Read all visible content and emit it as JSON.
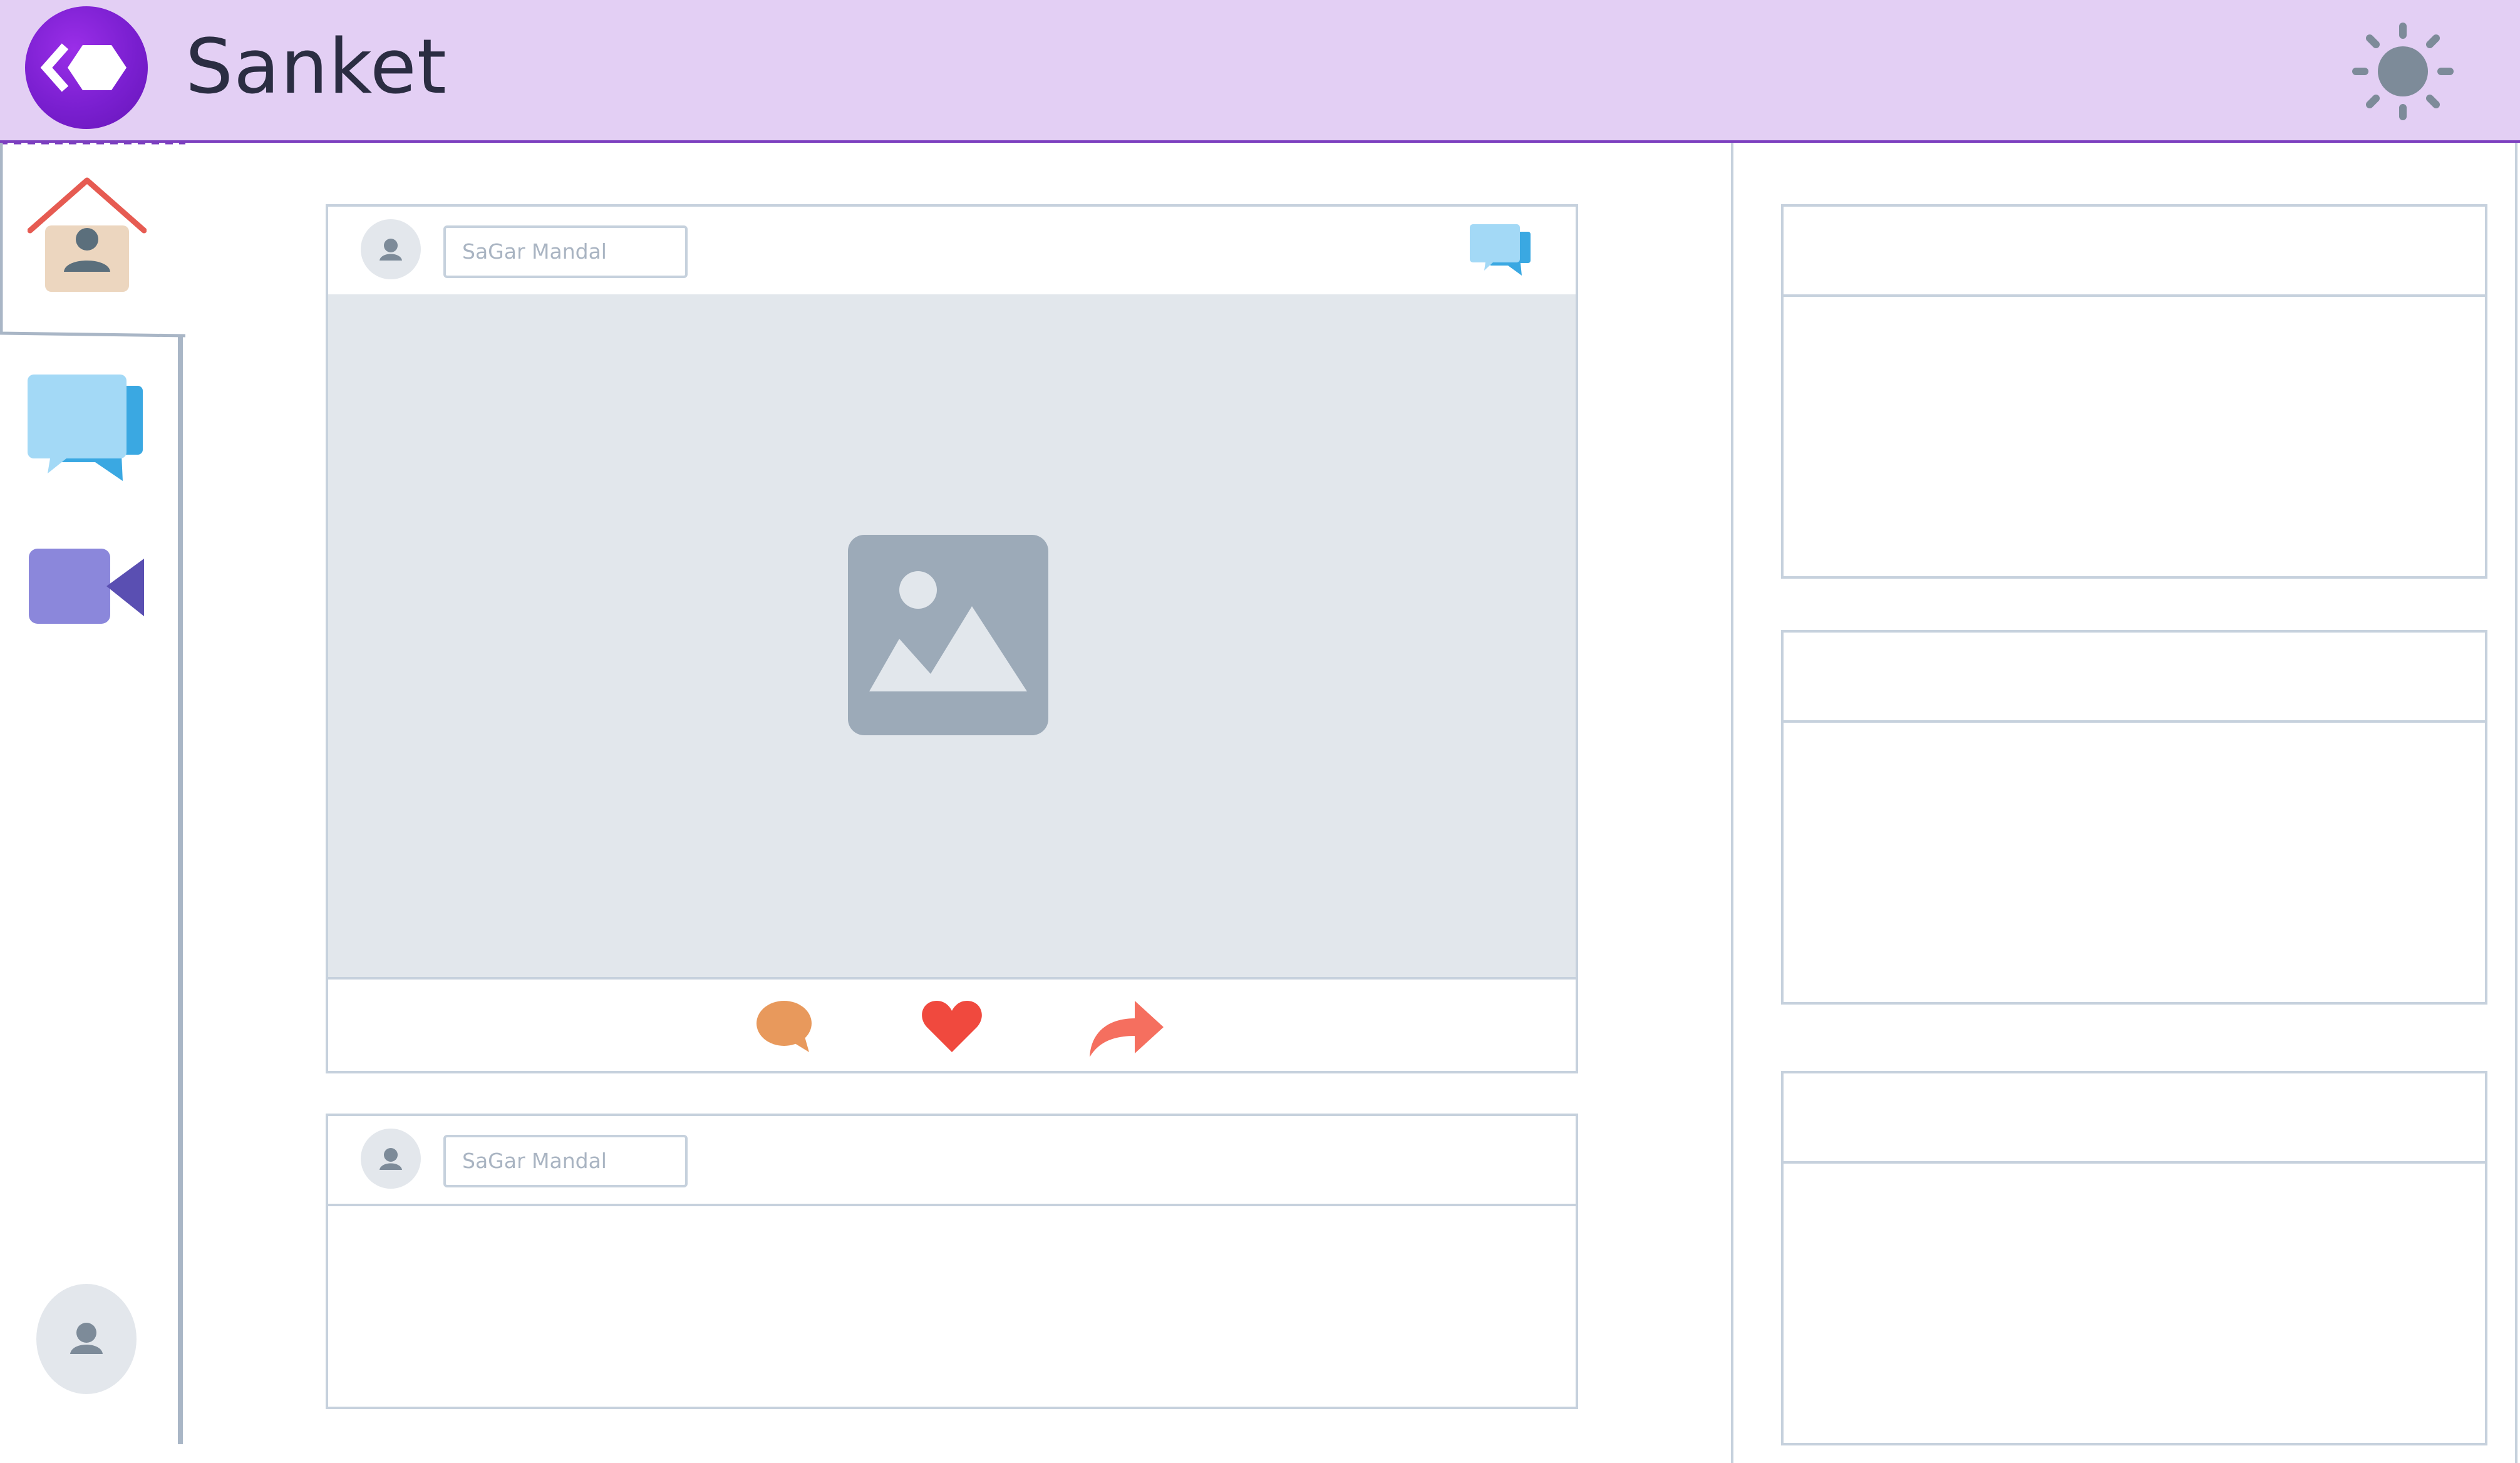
{
  "app": {
    "title": "Sanket"
  },
  "colors": {
    "header_bg": "#e3cff4",
    "brand": "#7a1fd0",
    "border": "#c6d1dd",
    "media_bg": "#e2e7ec",
    "comment": "#e8995c",
    "like": "#f0493e",
    "share": "#f56f5f"
  },
  "header": {
    "logo_icon": "diamond-logo-icon",
    "theme_icon": "sun-icon"
  },
  "sidebar": {
    "items": [
      {
        "name": "home",
        "icon": "home-icon",
        "active": true
      },
      {
        "name": "chat",
        "icon": "chat-icon"
      },
      {
        "name": "video",
        "icon": "video-camera-icon"
      }
    ],
    "user_icon": "user-icon"
  },
  "feed": {
    "posts": [
      {
        "author_placeholder": "SaGar Mandal",
        "has_media": true,
        "icons": [
          "chat-icon",
          "image-icon",
          "comment-icon",
          "heart-icon",
          "share-icon"
        ]
      },
      {
        "author_placeholder": "SaGar Mandal",
        "has_media": false
      }
    ]
  },
  "right_panel": {
    "widgets": [
      {},
      {},
      {}
    ]
  }
}
